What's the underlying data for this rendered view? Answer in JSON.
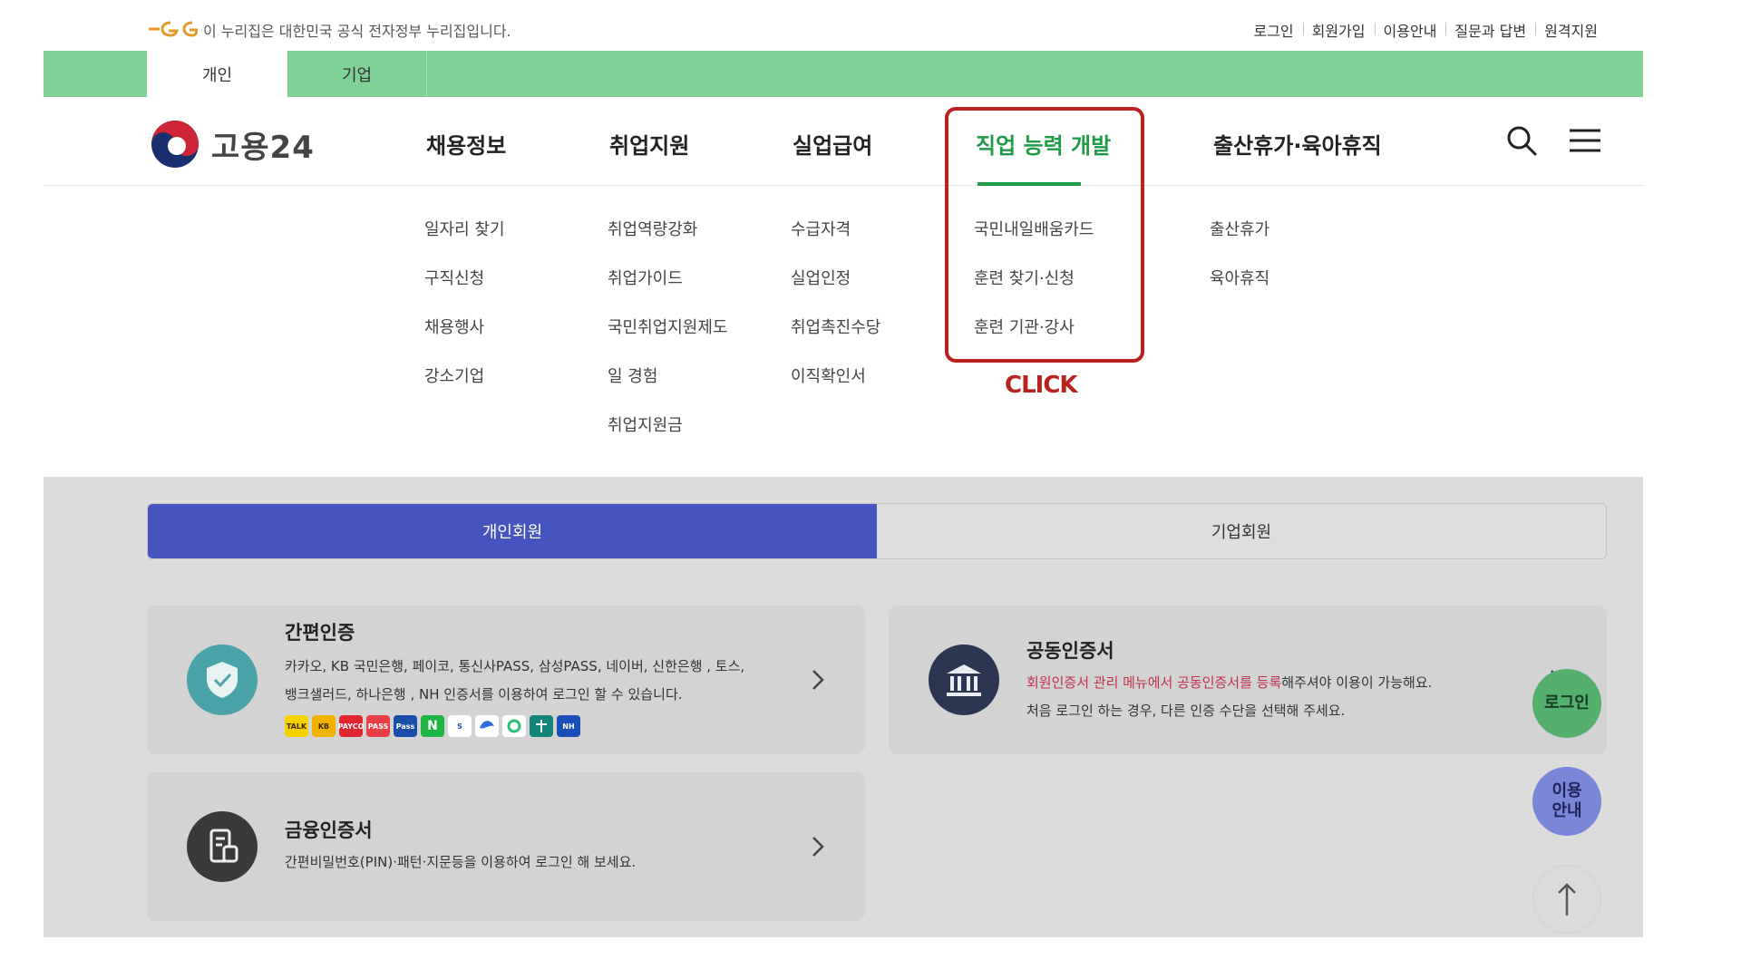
{
  "gov_bar": {
    "text": "이 누리집은 대한민국 공식 전자정부 누리집입니다.",
    "util_menu": [
      "로그인",
      "회원가입",
      "이용안내",
      "질문과 답변",
      "원격지원"
    ]
  },
  "user_tabs": {
    "personal": "개인",
    "business": "기업"
  },
  "brand": {
    "name": "고용24"
  },
  "gnb": [
    {
      "label": "채용정보",
      "items": [
        "일자리 찾기",
        "구직신청",
        "채용행사",
        "강소기업"
      ]
    },
    {
      "label": "취업지원",
      "items": [
        "취업역량강화",
        "취업가이드",
        "국민취업지원제도",
        "일 경험",
        "취업지원금"
      ]
    },
    {
      "label": "실업급여",
      "items": [
        "수급자격",
        "실업인정",
        "취업촉진수당",
        "이직확인서"
      ]
    },
    {
      "label": "직업 능력 개발",
      "items": [
        "국민내일배움카드",
        "훈련 찾기·신청",
        "훈련 기관·강사"
      ]
    },
    {
      "label": "출산휴가·육아휴직",
      "items": [
        "출산휴가",
        "육아휴직"
      ]
    }
  ],
  "annotation": {
    "click": "CLICK"
  },
  "member_tabs": {
    "personal": "개인회원",
    "business": "기업회원"
  },
  "cards": {
    "simple": {
      "title": "간편인증",
      "desc_line1": "카카오, KB 국민은행, 페이코, 통신사PASS, 삼성PASS, 네이버, 신한은행 , 토스,",
      "desc_line2": "뱅크샐러드, 하나은행 , NH 인증서를 이용하여 로그인 할 수 있습니다.",
      "chips": [
        "TALK",
        "KB",
        "PAYCO",
        "PASS",
        "Pass",
        "N",
        "S",
        "",
        "",
        "",
        "NH"
      ]
    },
    "joint": {
      "title": "공동인증서",
      "desc_red": "회원인증서 관리 메뉴에서 공동인증서를 등록",
      "desc_rest": "해주셔야 이용이 가능해요.",
      "desc_line2": "처음 로그인 하는 경우, 다른 인증 수단을 선택해 주세요."
    },
    "finance": {
      "title": "금융인증서",
      "desc": "간편비밀번호(PIN)·패턴·지문등을 이용하여 로그인 해 보세요."
    }
  },
  "float": {
    "login": "로그인",
    "guide_line1": "이용",
    "guide_line2": "안내"
  },
  "colors": {
    "green": "#7fd196",
    "active_green": "#1e9a48",
    "blue": "#4654bf",
    "highlight": "#b8221f"
  }
}
